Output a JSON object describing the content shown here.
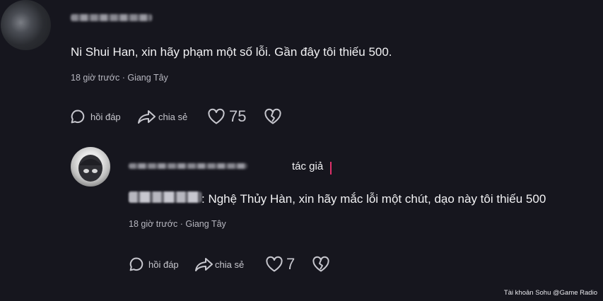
{
  "comments": [
    {
      "text": "Ni Shui Han, xin hãy phạm một số lỗi. Gần đây tôi thiếu 500.",
      "time": "18 giờ trước",
      "location": "Giang Tây",
      "reply_label": "hồi đáp",
      "share_label": "chia sẻ",
      "like_count": "75"
    },
    {
      "author_badge": "tác giả",
      "text": ": Nghệ Thủy Hàn, xin hãy mắc lỗi một chút, dạo này tôi thiếu 500",
      "time": "18 giờ trước",
      "location": "Giang Tây",
      "reply_label": "hồi đáp",
      "share_label": "chia sẻ",
      "like_count": "7"
    }
  ],
  "meta_separator": " · ",
  "watermark": "Tài khoản Sohu @Game Radio",
  "icons": {
    "reply": "speech-bubble-icon",
    "share": "share-arrow-icon",
    "like": "heart-outline-icon",
    "dislike": "broken-heart-icon"
  },
  "colors": {
    "background": "#16161e",
    "caret": "#e0306a"
  }
}
